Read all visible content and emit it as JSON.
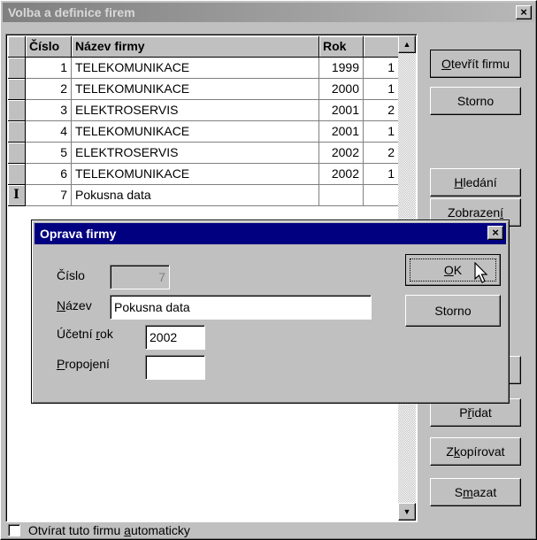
{
  "window": {
    "title": "Volba a definice firem",
    "close_glyph": "×"
  },
  "grid": {
    "columns": [
      "Číslo",
      "Název firmy",
      "Rok",
      ""
    ],
    "rows": [
      {
        "num": "1",
        "name": "TELEKOMUNIKACE",
        "rok": "1999",
        "x": "1",
        "marker": ""
      },
      {
        "num": "2",
        "name": "TELEKOMUNIKACE",
        "rok": "2000",
        "x": "1",
        "marker": ""
      },
      {
        "num": "3",
        "name": "ELEKTROSERVIS",
        "rok": "2001",
        "x": "2",
        "marker": ""
      },
      {
        "num": "4",
        "name": "TELEKOMUNIKACE",
        "rok": "2001",
        "x": "1",
        "marker": ""
      },
      {
        "num": "5",
        "name": "ELEKTROSERVIS",
        "rok": "2002",
        "x": "2",
        "marker": ""
      },
      {
        "num": "6",
        "name": "TELEKOMUNIKACE",
        "rok": "2002",
        "x": "1",
        "marker": ""
      },
      {
        "num": "7",
        "name": "Pokusna data",
        "rok": "",
        "x": "",
        "marker": "I"
      }
    ]
  },
  "side_buttons": {
    "open": {
      "pre": "",
      "key": "O",
      "post": "tevřít firmu"
    },
    "storno": {
      "pre": "Storno",
      "key": "",
      "post": ""
    },
    "find": {
      "pre": "",
      "key": "H",
      "post": "ledání"
    },
    "display": {
      "pre": "Zobrazen",
      "key": "í",
      "post": ""
    },
    "add": {
      "pre": "P",
      "key": "ř",
      "post": "idat"
    },
    "copy": {
      "pre": "Z",
      "key": "k",
      "post": "opírovat"
    },
    "delete": {
      "pre": "S",
      "key": "m",
      "post": "azat"
    }
  },
  "checkbox": {
    "label_pre": "Otvírat tuto firmu ",
    "label_key": "a",
    "label_post": "utomaticky",
    "checked": false
  },
  "dialog": {
    "title": "Oprava firmy",
    "close_glyph": "×",
    "cislo_label": "Číslo",
    "cislo_value": "7",
    "nazev_label_key": "N",
    "nazev_label_post": "ázev",
    "nazev_value": "Pokusna data",
    "rok_label_pre": "Účetní ",
    "rok_label_key": "r",
    "rok_label_post": "ok",
    "rok_value": "2002",
    "propojeni_label_key": "P",
    "propojeni_label_post": "ropojení",
    "propojeni_value": "",
    "ok": {
      "pre": "",
      "key": "O",
      "post": "K"
    },
    "storno": "Storno"
  },
  "scroll": {
    "up_glyph": "▲",
    "down_glyph": "▼"
  }
}
